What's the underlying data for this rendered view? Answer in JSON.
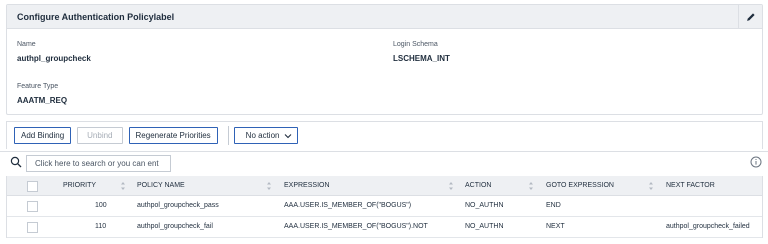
{
  "panel": {
    "title": "Configure Authentication Policylabel",
    "edit_icon": "pencil-icon",
    "fields": {
      "name_label": "Name",
      "name_value": "authpl_groupcheck",
      "login_schema_label": "Login Schema",
      "login_schema_value": "LSCHEMA_INT",
      "feature_type_label": "Feature Type",
      "feature_type_value": "AAATM_REQ"
    }
  },
  "toolbar": {
    "add_binding": "Add Binding",
    "unbind": "Unbind",
    "regenerate": "Regenerate Priorities",
    "action_dropdown": "No action"
  },
  "search": {
    "placeholder": "Click here to search or you can ent",
    "search_icon": "search-icon",
    "info_icon": "info-icon"
  },
  "table": {
    "columns": [
      "PRIORITY",
      "POLICY NAME",
      "EXPRESSION",
      "ACTION",
      "GOTO EXPRESSION",
      "NEXT FACTOR"
    ],
    "rows": [
      {
        "priority": "100",
        "policy_name": "authpol_groupcheck_pass",
        "expression": "AAA.USER.IS_MEMBER_OF(\"BOGUS\")",
        "action": "NO_AUTHN",
        "goto": "END",
        "next_factor": ""
      },
      {
        "priority": "110",
        "policy_name": "authpol_groupcheck_fail",
        "expression": "AAA.USER.IS_MEMBER_OF(\"BOGUS\").NOT",
        "action": "NO_AUTHN",
        "goto": "NEXT",
        "next_factor": "authpol_groupcheck_failed"
      }
    ]
  },
  "colors": {
    "accent": "#2f62b6",
    "header_bg": "#eef0f3",
    "border": "#dcdfe4"
  }
}
